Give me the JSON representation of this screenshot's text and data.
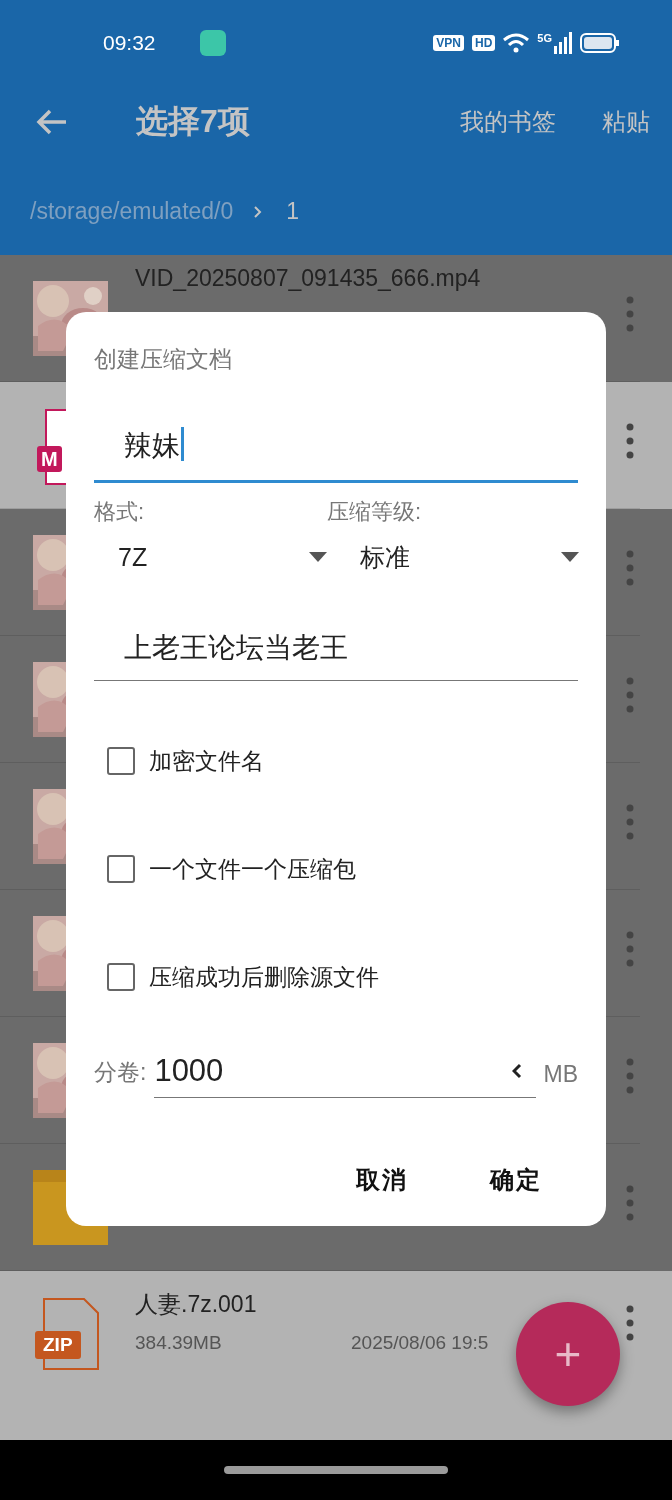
{
  "status_bar": {
    "time": "09:32",
    "badges": [
      "VPN",
      "HD"
    ],
    "network": "5G"
  },
  "app_bar": {
    "title": "选择7项",
    "actions": [
      "我的书签",
      "粘贴"
    ]
  },
  "breadcrumb": {
    "path": "/storage/emulated/0",
    "current": "1"
  },
  "files": [
    {
      "kind": "video",
      "selected": true,
      "name": "VID_20250807_091435_666.mp4"
    },
    {
      "kind": "document",
      "selected": false,
      "badge": "M"
    },
    {
      "kind": "video",
      "selected": true
    },
    {
      "kind": "video",
      "selected": true
    },
    {
      "kind": "video",
      "selected": true
    },
    {
      "kind": "video",
      "selected": true
    },
    {
      "kind": "video",
      "selected": true
    },
    {
      "kind": "folder",
      "selected": true
    },
    {
      "kind": "archive",
      "selected": false,
      "badge": "ZIP",
      "name": "人妻.7z.001",
      "size": "384.39MB",
      "date": "2025/08/06 19:5"
    }
  ],
  "dialog": {
    "title": "创建压缩文档",
    "name_field": {
      "value": "辣妹",
      "focused": true
    },
    "format": {
      "label": "格式:",
      "value": "7Z"
    },
    "level": {
      "label": "压缩等级:",
      "value": "标准"
    },
    "password_field": {
      "value": "上老王论坛当老王",
      "focused": false
    },
    "options": [
      {
        "label": "加密文件名",
        "checked": false
      },
      {
        "label": "一个文件一个压缩包",
        "checked": false
      },
      {
        "label": "压缩成功后删除源文件",
        "checked": false
      }
    ],
    "split": {
      "label": "分卷:",
      "value": "1000",
      "unit": "MB"
    },
    "buttons": [
      "取消",
      "确定"
    ]
  },
  "fab": {
    "label": "+"
  }
}
